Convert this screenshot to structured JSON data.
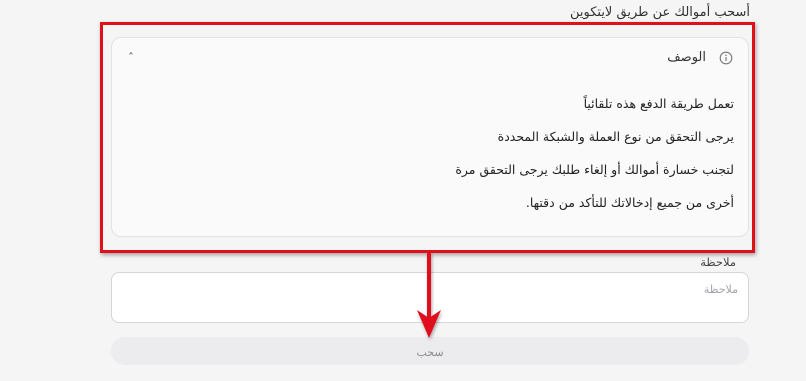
{
  "header": {
    "withdraw_title": "أسحب أموالك عن طريق لايتكوين"
  },
  "description_card": {
    "title": "الوصف",
    "toggle_glyph": "ˆ",
    "lines": [
      "تعمل طريقة الدفع هذه تلقائياً",
      "يرجى التحقق من نوع العملة والشبكة المحددة",
      "لتجنب خسارة أموالك أو إلغاء طلبك يرجى التحقق مرة",
      "أخرى من جميع إدخالاتك للتأكد من دقتها."
    ]
  },
  "note": {
    "label": "ملاحظة",
    "placeholder": "ملاحظة",
    "value": ""
  },
  "withdraw_button": {
    "label": "سحب"
  },
  "annotations": {
    "highlight_color": "#e0101a",
    "arrow_color": "#e0101a"
  },
  "colors": {
    "background": "#f5f5f6",
    "card_border": "#e2e2e6",
    "button_bg": "#ececef"
  }
}
